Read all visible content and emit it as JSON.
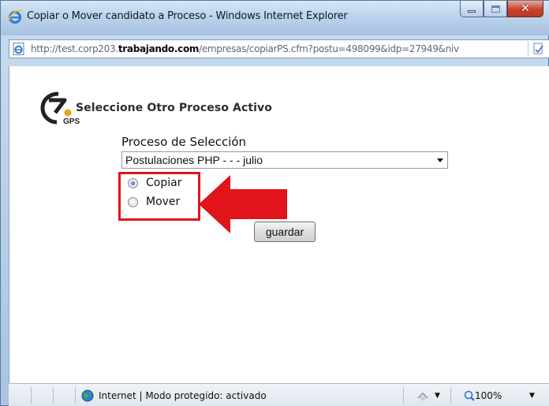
{
  "window": {
    "title": "Copiar o Mover candidato a Proceso - Windows Internet Explorer"
  },
  "address": {
    "url_prefix": "http://test.corp203.",
    "url_domain": "trabajando.com",
    "url_suffix": "/empresas/copiarPS.cfm?postu=498099&idp=27949&niv"
  },
  "page": {
    "heading": "Seleccione Otro Proceso Activo",
    "field_label": "Proceso de Selección",
    "select_value": "Postulaciones PHP - - - julio",
    "radio_options": [
      {
        "label": "Copiar",
        "checked": true
      },
      {
        "label": "Mover",
        "checked": false
      }
    ],
    "save_label": "guardar",
    "annotation_color": "#e0141a"
  },
  "status": {
    "zone_text": "Internet | Modo protegido: activado",
    "zoom": "100%"
  }
}
